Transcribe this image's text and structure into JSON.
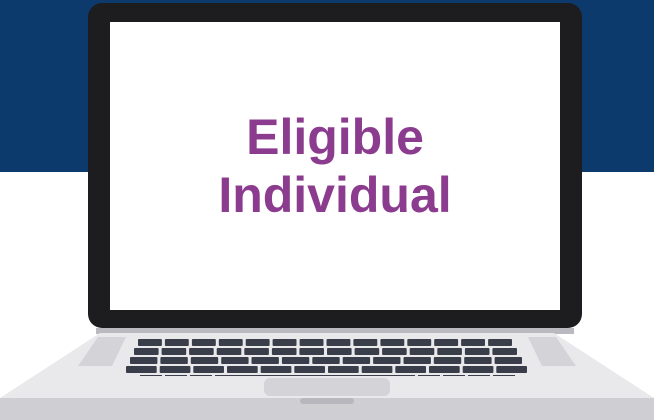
{
  "screen": {
    "lines": [
      "Eligible",
      "Individual"
    ]
  },
  "colors": {
    "band": "#0d3a6c",
    "text": "#8c3c8e",
    "bezel": "#1d1d1f",
    "display": "#ffffff",
    "keys": "#3a3e4a",
    "deck": "#e9e9ec",
    "deck_shadow": "#cfcfd3"
  },
  "icons": {
    "laptop": "laptop-icon"
  }
}
